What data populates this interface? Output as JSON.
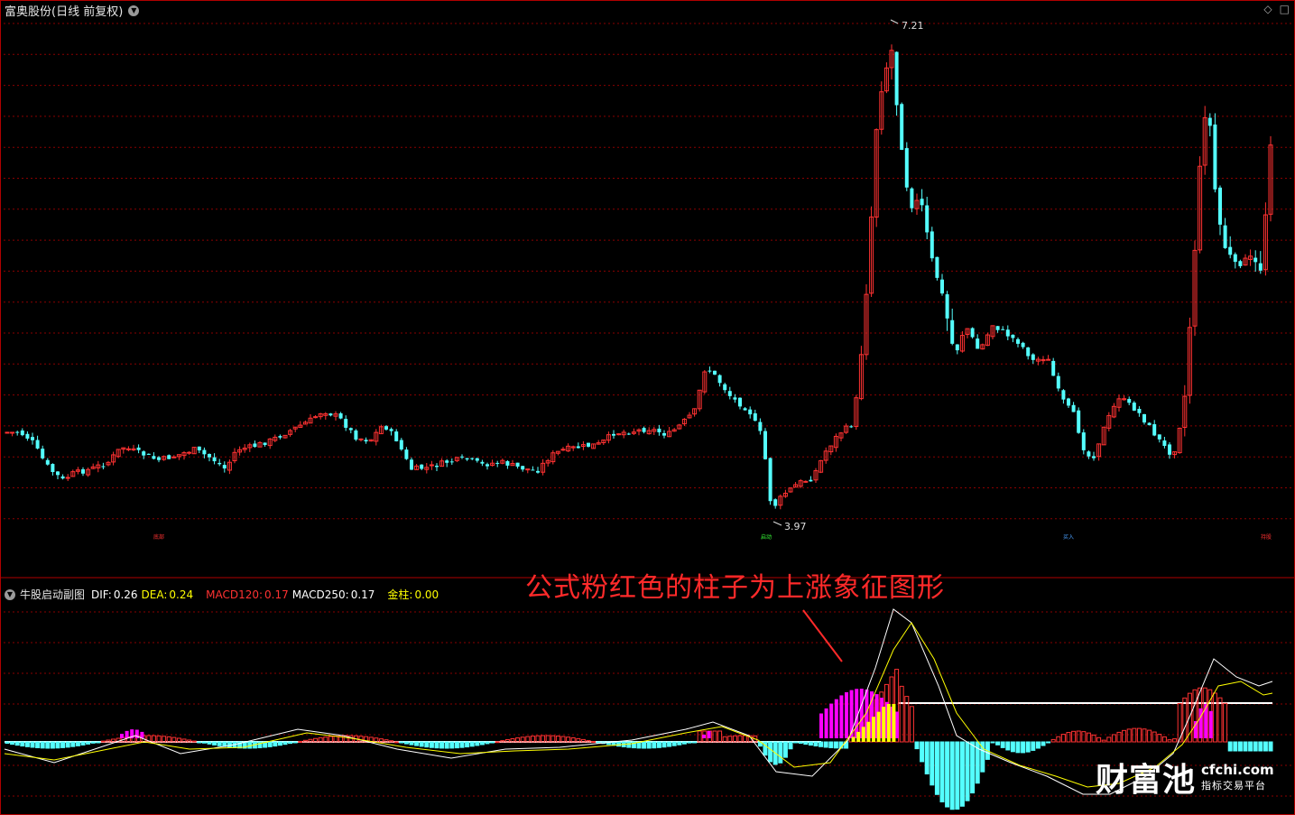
{
  "window": {
    "title": "富奥股份(日线 前复权)",
    "controls": [
      "◇",
      "□"
    ]
  },
  "price_chart": {
    "high_label": "7.21",
    "low_label": "3.97",
    "markers": [
      "底部",
      "启动",
      "买入",
      "持股"
    ],
    "colors": {
      "up": "#ff3232",
      "down": "#54ffff",
      "grid": "#8a0000"
    }
  },
  "indicator": {
    "name": "牛股启动副图",
    "dif_label": "DIF:",
    "dif_value": "0.26",
    "dea_label": "DEA:",
    "dea_value": "0.24",
    "macd120_label": "MACD120:",
    "macd120_value": "0.17",
    "macd250_label": "MACD250:",
    "macd250_value": "0.17",
    "jinzhu_label": "金柱:",
    "jinzhu_value": "0.00",
    "colors": {
      "dif": "#ffffff",
      "dea": "#ffff00",
      "macd120": "#ff3232",
      "macd250": "#ffffff",
      "jinzhu": "#ffff00",
      "pink": "#ff00ff"
    }
  },
  "annotation": {
    "text": "公式粉红色的柱子为上涨象征图形"
  },
  "watermark": {
    "logo": "财富池",
    "domain": "cfchi.com",
    "tagline": "指标交易平台"
  }
}
